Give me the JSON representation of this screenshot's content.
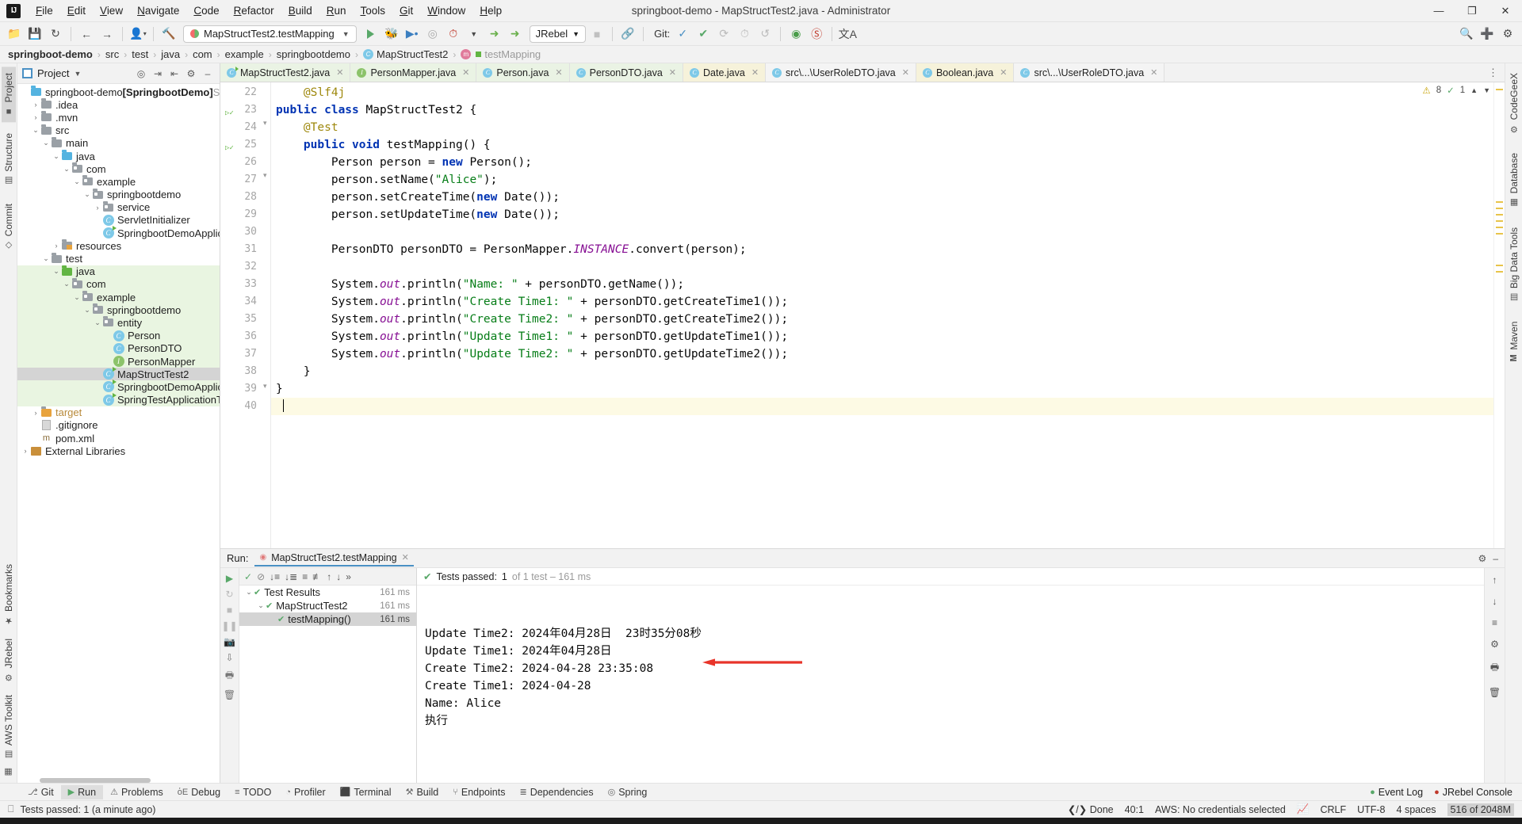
{
  "window": {
    "title": "springboot-demo - MapStructTest2.java - Administrator",
    "minimize": "—",
    "maximize": "❐",
    "close": "✕"
  },
  "menu": [
    "File",
    "Edit",
    "View",
    "Navigate",
    "Code",
    "Refactor",
    "Build",
    "Run",
    "Tools",
    "Git",
    "Window",
    "Help"
  ],
  "toolbar": {
    "open_icon": "open-folder-icon",
    "save_icon": "save-icon",
    "sync_icon": "sync-icon",
    "back_icon": "back-arrow-icon",
    "forward_icon": "forward-arrow-icon",
    "profile_icon": "user-profile-icon",
    "build_icon": "hammer-icon",
    "run_config": "MapStructTest2.testMapping",
    "run_icon": "run-icon",
    "debug_icon": "debug-icon",
    "run_coverage_icon": "run-with-coverage-icon",
    "profiler_icon": "profiler-icon",
    "jrebel_run_icon": "jrebel-run-icon",
    "jrebel_debug_icon": "jrebel-debug-icon",
    "jrebel_label": "JRebel",
    "stop_icon": "stop-icon",
    "git_label": "Git:",
    "git_update_icon": "git-update-icon",
    "git_commit_icon": "git-commit-icon",
    "git_push_icon": "git-push-icon",
    "history_icon": "history-icon",
    "rollback_icon": "rollback-icon",
    "search_icon": "search-everywhere-icon",
    "settings_icon": "settings-icon",
    "layout_icon": "layout-icon",
    "inspect_icon": "inspection-icon",
    "translate_icon": "translate-icon",
    "noentry_icon": "no-entry-icon"
  },
  "breadcrumbs": [
    {
      "label": "springboot-demo",
      "style": "bold"
    },
    {
      "label": "src",
      "style": "normal"
    },
    {
      "label": "test",
      "style": "normal"
    },
    {
      "label": "java",
      "style": "normal"
    },
    {
      "label": "com",
      "style": "normal"
    },
    {
      "label": "example",
      "style": "normal"
    },
    {
      "label": "springbootdemo",
      "style": "normal"
    },
    {
      "label": "MapStructTest2",
      "style": "class"
    },
    {
      "label": "testMapping",
      "style": "dim"
    }
  ],
  "left_strip": [
    "Project",
    "Structure",
    "Commit"
  ],
  "right_strip": [
    "CodeGeeX",
    "Database",
    "Big Data Tools",
    "Maven"
  ],
  "bottom_left_strip": [
    "Bookmarks",
    "JRebel",
    "AWS Toolkit"
  ],
  "project_panel": {
    "title": "Project",
    "actions": [
      "locate-icon",
      "expand-all-icon",
      "collapse-all-icon",
      "settings-icon",
      "hide-icon"
    ],
    "tree": [
      {
        "indent": 0,
        "arrow": "none",
        "icon": "module",
        "label": "springboot-demo",
        "suffix": "[SpringbootDemo]",
        "tail": "SpringbootDe",
        "state": "normal"
      },
      {
        "indent": 1,
        "arrow": "collapsed",
        "icon": "folder-gray",
        "label": ".idea",
        "state": "normal"
      },
      {
        "indent": 1,
        "arrow": "collapsed",
        "icon": "folder-gray",
        "label": ".mvn",
        "state": "normal"
      },
      {
        "indent": 1,
        "arrow": "expanded",
        "icon": "folder-gray",
        "label": "src",
        "state": "normal"
      },
      {
        "indent": 2,
        "arrow": "expanded",
        "icon": "folder-gray",
        "label": "main",
        "state": "normal"
      },
      {
        "indent": 3,
        "arrow": "expanded",
        "icon": "folder-blue",
        "label": "java",
        "state": "normal"
      },
      {
        "indent": 4,
        "arrow": "expanded",
        "icon": "package",
        "label": "com",
        "state": "normal"
      },
      {
        "indent": 5,
        "arrow": "expanded",
        "icon": "package",
        "label": "example",
        "state": "normal"
      },
      {
        "indent": 6,
        "arrow": "expanded",
        "icon": "package",
        "label": "springbootdemo",
        "state": "normal"
      },
      {
        "indent": 7,
        "arrow": "collapsed",
        "icon": "package",
        "label": "service",
        "state": "normal"
      },
      {
        "indent": 7,
        "arrow": "none",
        "icon": "class",
        "label": "ServletInitializer",
        "state": "normal"
      },
      {
        "indent": 7,
        "arrow": "none",
        "icon": "class-run",
        "label": "SpringbootDemoApplication",
        "state": "normal"
      },
      {
        "indent": 3,
        "arrow": "collapsed",
        "icon": "folder-res",
        "label": "resources",
        "state": "normal"
      },
      {
        "indent": 2,
        "arrow": "expanded",
        "icon": "folder-gray",
        "label": "test",
        "state": "normal"
      },
      {
        "indent": 3,
        "arrow": "expanded",
        "icon": "folder-green",
        "label": "java",
        "state": "green"
      },
      {
        "indent": 4,
        "arrow": "expanded",
        "icon": "package",
        "label": "com",
        "state": "green"
      },
      {
        "indent": 5,
        "arrow": "expanded",
        "icon": "package",
        "label": "example",
        "state": "green"
      },
      {
        "indent": 6,
        "arrow": "expanded",
        "icon": "package",
        "label": "springbootdemo",
        "state": "green"
      },
      {
        "indent": 7,
        "arrow": "expanded",
        "icon": "package",
        "label": "entity",
        "state": "green"
      },
      {
        "indent": 8,
        "arrow": "none",
        "icon": "class",
        "label": "Person",
        "state": "green"
      },
      {
        "indent": 8,
        "arrow": "none",
        "icon": "class",
        "label": "PersonDTO",
        "state": "green"
      },
      {
        "indent": 8,
        "arrow": "none",
        "icon": "interface",
        "label": "PersonMapper",
        "state": "green"
      },
      {
        "indent": 7,
        "arrow": "none",
        "icon": "class-run",
        "label": "MapStructTest2",
        "state": "selected"
      },
      {
        "indent": 7,
        "arrow": "none",
        "icon": "class-run",
        "label": "SpringbootDemoApplicationTests",
        "state": "green"
      },
      {
        "indent": 7,
        "arrow": "none",
        "icon": "class-run",
        "label": "SpringTestApplicationTests",
        "state": "green"
      },
      {
        "indent": 1,
        "arrow": "collapsed",
        "icon": "folder-orange",
        "label": "target",
        "state": "orange"
      },
      {
        "indent": 1,
        "arrow": "none",
        "icon": "file",
        "label": ".gitignore",
        "state": "normal"
      },
      {
        "indent": 1,
        "arrow": "none",
        "icon": "maven",
        "label": "pom.xml",
        "state": "normal"
      },
      {
        "indent": 0,
        "arrow": "collapsed",
        "icon": "library",
        "label": "External Libraries",
        "state": "normal"
      }
    ]
  },
  "editor_tabs": [
    {
      "label": "MapStructTest2.java",
      "icon": "test-class-icon",
      "active": true,
      "color": "green"
    },
    {
      "label": "PersonMapper.java",
      "icon": "interface-icon",
      "active": false,
      "color": "green"
    },
    {
      "label": "Person.java",
      "icon": "class-icon",
      "active": false,
      "color": "green"
    },
    {
      "label": "PersonDTO.java",
      "icon": "class-icon",
      "active": false,
      "color": "green"
    },
    {
      "label": "Date.java",
      "icon": "class-icon",
      "active": false,
      "color": "yellow"
    },
    {
      "label": "src\\...\\UserRoleDTO.java",
      "icon": "class-icon",
      "active": false,
      "color": "plain"
    },
    {
      "label": "Boolean.java",
      "icon": "class-icon",
      "active": false,
      "color": "yellow"
    },
    {
      "label": "src\\...\\UserRoleDTO.java",
      "icon": "class-icon",
      "active": false,
      "color": "plain"
    }
  ],
  "inspections": {
    "warnings": "8",
    "checks": "1",
    "warn_icon": "warning-triangle-icon",
    "ok_icon": "check-icon",
    "up_icon": "chevron-up-icon",
    "down_icon": "chevron-down-icon"
  },
  "editor": {
    "first_line": 22,
    "lines": [
      {
        "n": 22,
        "html": "    <span class=\"ann\">@Slf4j</span>"
      },
      {
        "n": 23,
        "html": "<span class=\"kw\">public class</span> <span class=\"cls\">MapStructTest2</span> {"
      },
      {
        "n": 24,
        "html": "    <span class=\"ann\">@Test</span>"
      },
      {
        "n": 25,
        "html": "    <span class=\"kw\">public void</span> testMapping() {"
      },
      {
        "n": 26,
        "html": "        Person person = <span class=\"kw\">new</span> Person();"
      },
      {
        "n": 27,
        "html": "        person.setName(<span class=\"str\">\"Alice\"</span>);"
      },
      {
        "n": 28,
        "html": "        person.setCreateTime(<span class=\"kw\">new</span> Date());"
      },
      {
        "n": 29,
        "html": "        person.setUpdateTime(<span class=\"kw\">new</span> Date());"
      },
      {
        "n": 30,
        "html": ""
      },
      {
        "n": 31,
        "html": "        PersonDTO personDTO = PersonMapper.<span class=\"fld\">INSTANCE</span>.convert(person);"
      },
      {
        "n": 32,
        "html": ""
      },
      {
        "n": 33,
        "html": "        System.<span class=\"fld\">out</span>.println(<span class=\"str\">\"Name: \"</span> + personDTO.getName());"
      },
      {
        "n": 34,
        "html": "        System.<span class=\"fld\">out</span>.println(<span class=\"str\">\"Create Time1: \"</span> + personDTO.getCreateTime1());"
      },
      {
        "n": 35,
        "html": "        System.<span class=\"fld\">out</span>.println(<span class=\"str\">\"Create Time2: \"</span> + personDTO.getCreateTime2());"
      },
      {
        "n": 36,
        "html": "        System.<span class=\"fld\">out</span>.println(<span class=\"str\">\"Update Time1: \"</span> + personDTO.getUpdateTime1());"
      },
      {
        "n": 37,
        "html": "        System.<span class=\"fld\">out</span>.println(<span class=\"str\">\"Update Time2: \"</span> + personDTO.getUpdateTime2());"
      },
      {
        "n": 38,
        "html": "    }"
      },
      {
        "n": 39,
        "html": "}"
      },
      {
        "n": 40,
        "html": "",
        "highlight": true
      }
    ]
  },
  "run_panel": {
    "label": "Run:",
    "tab": "MapStructTest2.testMapping",
    "close_icon": "close-icon",
    "settings_icon": "settings-icon",
    "hide_icon": "hide-icon",
    "toolstrip": [
      "rerun-icon",
      "rerun-failed-icon",
      "stop-icon",
      "pause-icon",
      "trash-icon",
      "print-icon",
      "delete-icon",
      "scroll-icon"
    ],
    "tests_toolbar": [
      "check-icon",
      "ignore-icon",
      "sort-alpha-icon",
      "sort-duration-icon",
      "expand-icon",
      "collapse-icon",
      "prev-icon",
      "next-icon",
      "more-icon"
    ],
    "status": {
      "text": "Tests passed:",
      "count": "1",
      "detail": "of 1 test – 161 ms",
      "icon": "check-icon"
    },
    "tests": [
      {
        "indent": 0,
        "arrow": "expanded",
        "label": "Test Results",
        "ms": "161 ms",
        "selected": false
      },
      {
        "indent": 1,
        "arrow": "expanded",
        "label": "MapStructTest2",
        "ms": "161 ms",
        "selected": false
      },
      {
        "indent": 2,
        "arrow": "none",
        "label": "testMapping()",
        "ms": "161 ms",
        "selected": true
      }
    ],
    "console_lines": [
      "执行",
      "Name: Alice",
      "Create Time1: 2024-04-28",
      "Create Time2: 2024-04-28 23:35:08",
      "Update Time1: 2024年04月28日",
      "Update Time2: 2024年04月28日  23时35分08秒"
    ],
    "annotation_arrow": {
      "color": "#e8342a",
      "name": "red-arrow-annotation"
    }
  },
  "toolwindow_bar": [
    {
      "label": "Git",
      "icon": "git-icon",
      "active": false
    },
    {
      "label": "Run",
      "icon": "run-icon",
      "active": true
    },
    {
      "label": "Problems",
      "icon": "problems-icon",
      "active": false
    },
    {
      "label": "Debug",
      "icon": "debug-icon",
      "active": false
    },
    {
      "label": "TODO",
      "icon": "todo-icon",
      "active": false
    },
    {
      "label": "Profiler",
      "icon": "profiler-icon",
      "active": false
    },
    {
      "label": "Terminal",
      "icon": "terminal-icon",
      "active": false
    },
    {
      "label": "Build",
      "icon": "build-icon",
      "active": false
    },
    {
      "label": "Endpoints",
      "icon": "endpoints-icon",
      "active": false
    },
    {
      "label": "Dependencies",
      "icon": "dependencies-icon",
      "active": false
    },
    {
      "label": "Spring",
      "icon": "spring-icon",
      "active": false
    }
  ],
  "toolwindow_right": [
    {
      "label": "Event Log",
      "icon": "event-log-icon"
    },
    {
      "label": "JRebel Console",
      "icon": "jrebel-icon"
    }
  ],
  "statusbar": {
    "left_icon": "terminal-window-icon",
    "left_text": "Tests passed: 1 (a minute ago)",
    "done": "Done",
    "done_icon": "code-brackets-icon",
    "position": "40:1",
    "aws": "AWS: No credentials selected",
    "aws_icon": "aws-icon",
    "line_sep": "CRLF",
    "encoding": "UTF-8",
    "indent": "4 spaces",
    "memory": "516 of 2048M"
  },
  "colors": {
    "accent_blue": "#4a90c4",
    "green": "#59a869",
    "tab_green": "#eaf3e4",
    "tab_yellow": "#f6f2da",
    "selection_gray": "#d4d4d4",
    "arrow_red": "#e8342a",
    "keyword_blue": "#0033b3",
    "string_green": "#067d17",
    "field_purple": "#871094",
    "annotation_gold": "#9e880d"
  }
}
